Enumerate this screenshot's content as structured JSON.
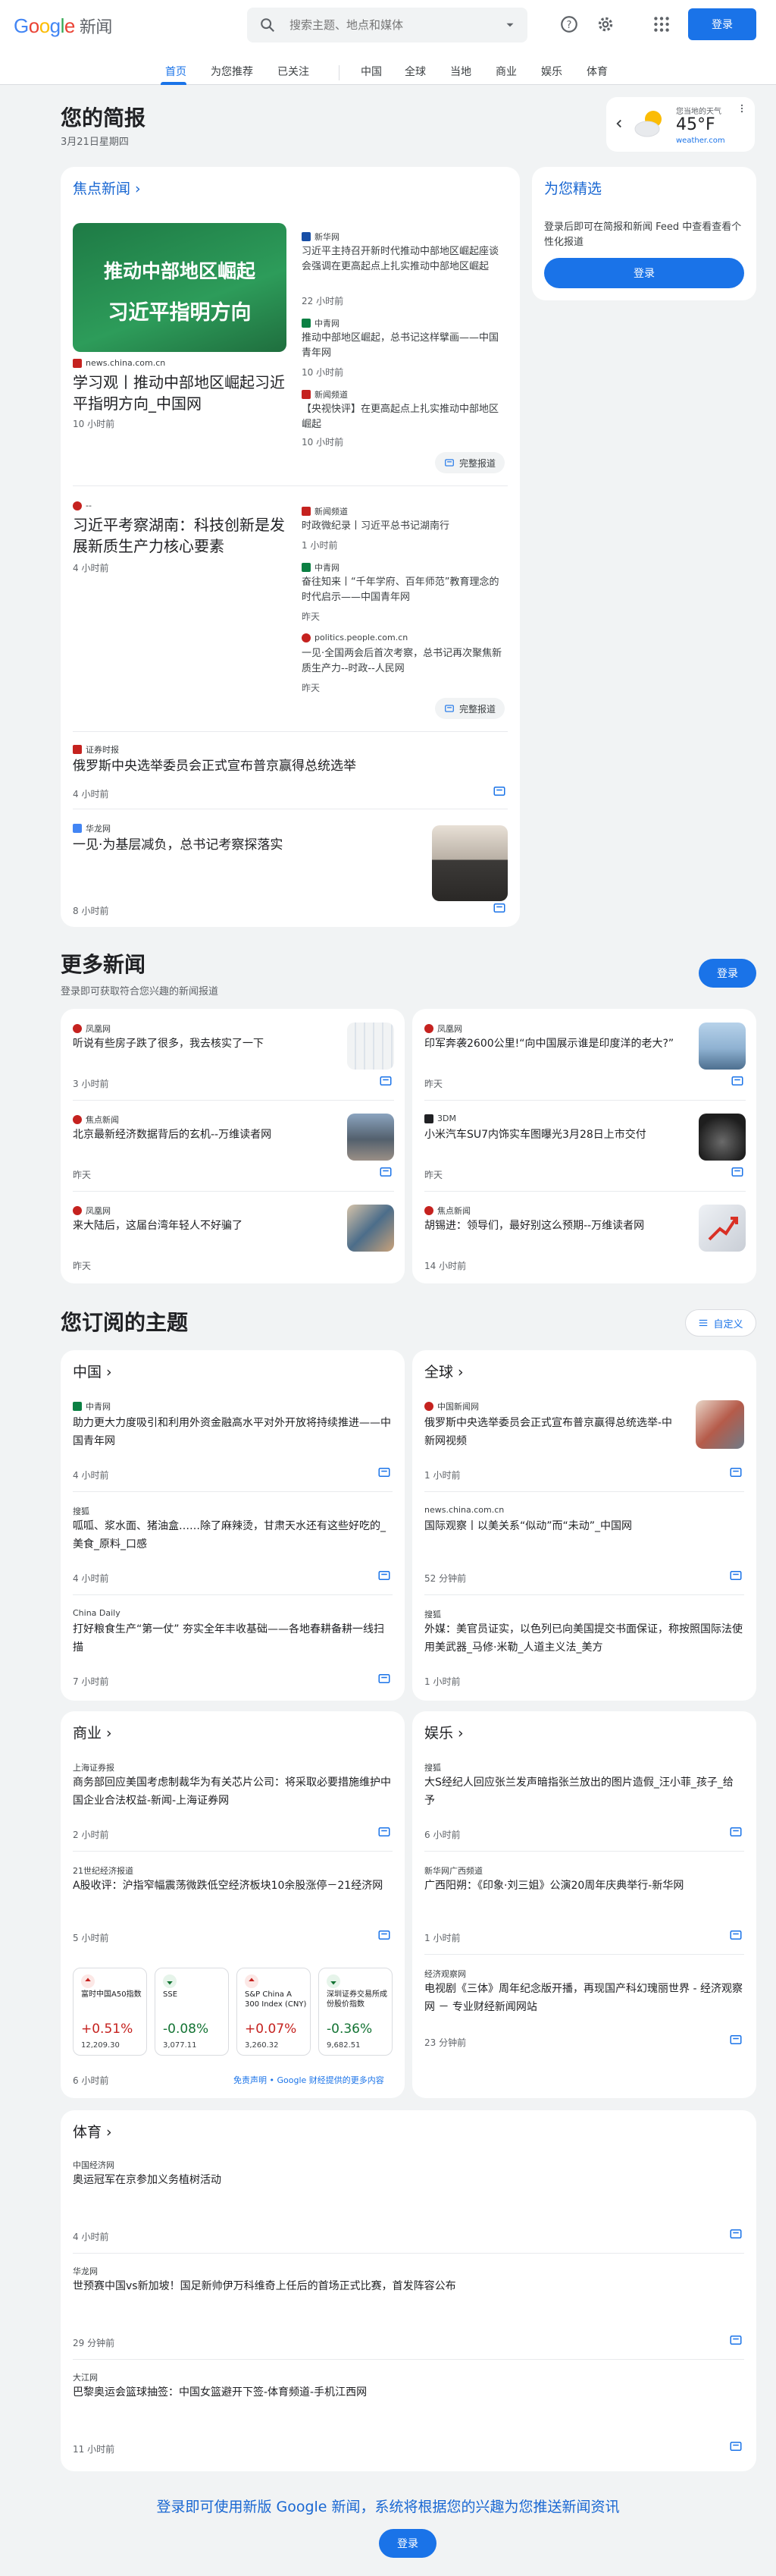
{
  "header": {
    "logo_google": "Google",
    "logo_news": "新闻",
    "search_placeholder": "搜索主题、地点和媒体",
    "signin": "登录"
  },
  "nav": [
    "首页",
    "为您推荐",
    "已关注",
    "中国",
    "全球",
    "当地",
    "商业",
    "娱乐",
    "体育"
  ],
  "briefing": {
    "title": "您的简报",
    "date": "3月21日星期四"
  },
  "weather": {
    "label": "您当地的天气",
    "temp": "45°F",
    "source": "weather.com"
  },
  "top": {
    "heading": "焦点新闻",
    "thumb_line1": "推动中部地区崛起",
    "thumb_line2": "习近平指明方向",
    "main1": {
      "source": "news.china.com.cn",
      "title": "学习观丨推动中部地区崛起习近平指明方向_中国网",
      "time": "10 小时前"
    },
    "side1": [
      {
        "source": "新华网",
        "title": "习近平主持召开新时代推动中部地区崛起座谈会强调在更高起点上扎实推动中部地区崛起",
        "time": "22 小时前"
      },
      {
        "source": "中青网",
        "title": "推动中部地区崛起，总书记这样擘画——中国青年网",
        "time": "10 小时前"
      },
      {
        "source": "新闻频道",
        "title": "【央视快评】在更高起点上扎实推动中部地区崛起",
        "time": "10 小时前"
      }
    ],
    "full_coverage": "完整报道",
    "main2": {
      "source": "--",
      "title": "习近平考察湖南：科技创新是发展新质生产力核心要素",
      "time": "4 小时前"
    },
    "side2": [
      {
        "source": "新闻频道",
        "title": "时政微纪录丨习近平总书记湖南行",
        "time": "1 小时前"
      },
      {
        "source": "中青网",
        "title": "奋往知来丨“千年学府、百年师范”教育理念的时代启示——中国青年网",
        "time": "昨天"
      },
      {
        "source": "politics.people.com.cn",
        "title": "一见·全国两会后首次考察，总书记再次聚焦新质生产力--时政--人民网",
        "time": "昨天"
      }
    ],
    "story3": {
      "source": "证券时报",
      "title": "俄罗斯中央选举委员会正式宣布普京赢得总统选举",
      "time": "4 小时前"
    },
    "story4": {
      "source": "华龙网",
      "title": "一见·为基层减负，总书记考察探落实",
      "time": "8 小时前"
    }
  },
  "picks": {
    "title": "为您精选",
    "text": "登录后即可在简报和新闻 Feed 中查看查看个性化报道",
    "button": "登录"
  },
  "more": {
    "title": "更多新闻",
    "sub": "登录即可获取符合您兴趣的新闻报道",
    "button": "登录",
    "items": [
      {
        "source": "凤凰网",
        "title": "听说有些房子跌了很多，我去核实了一下",
        "time": "3 小时前"
      },
      {
        "source": "凤凰网",
        "title": "印军奔袭2600公里!“向中国展示谁是印度洋的老大?”",
        "time": "昨天"
      },
      {
        "source": "焦点新闻",
        "title": "北京最新经济数据背后的玄机--万维读者网",
        "time": "昨天"
      },
      {
        "source": "3DM",
        "title": "小米汽车SU7内饰实车图曝光3月28日上市交付",
        "time": "昨天"
      },
      {
        "source": "凤凰网",
        "title": "来大陆后，这届台湾年轻人不好骗了",
        "time": "昨天"
      },
      {
        "source": "焦点新闻",
        "title": "胡锡进：领导们，最好别这么预期--万维读者网",
        "time": "14 小时前"
      }
    ]
  },
  "topics": {
    "title": "您订阅的主题",
    "customize": "自定义",
    "china": {
      "title": "中国",
      "items": [
        {
          "source": "中青网",
          "title": "助力更大力度吸引和利用外资金融高水平对外开放将持续推进——中国青年网",
          "time": "4 小时前"
        },
        {
          "source": "搜狐",
          "title": "呱呱、浆水面、猪油盒……除了麻辣烫，甘肃天水还有这些好吃的_美食_原料_口感",
          "time": "4 小时前"
        },
        {
          "source": "China Daily",
          "title": "打好粮食生产“第一仗” 夯实全年丰收基础——各地春耕备耕一线扫描",
          "time": "7 小时前"
        }
      ]
    },
    "world": {
      "title": "全球",
      "items": [
        {
          "source": "中国新闻网",
          "title": "俄罗斯中央选举委员会正式宣布普京赢得总统选举-中新网视频",
          "time": "1 小时前"
        },
        {
          "source": "news.china.com.cn",
          "title": "国际观察丨以美关系“似动”而“未动”_中国网",
          "time": "52 分钟前"
        },
        {
          "source": "搜狐",
          "title": "外媒：美官员证实，以色列已向美国提交书面保证，称按照国际法使用美武器_马修·米勒_人道主义法_美方",
          "time": "1 小时前"
        }
      ]
    },
    "biz": {
      "title": "商业",
      "items": [
        {
          "source": "上海证券报",
          "title": "商务部回应美国考虑制裁华为有关芯片公司：将采取必要措施维护中国企业合法权益-新闻-上海证券网",
          "time": "2 小时前"
        },
        {
          "source": "21世纪经济报道",
          "title": "A股收评：沪指窄幅震荡微跌低空经济板块10余股涨停－21经济网",
          "time": "5 小时前"
        }
      ],
      "stocks": [
        {
          "name": "富时中国A50指数",
          "change": "+0.51%",
          "value": "12,209.30",
          "up": false
        },
        {
          "name": "SSE",
          "change": "-0.08%",
          "value": "3,077.11",
          "up": true
        },
        {
          "name": "S&P China A 300 Index (CNY)",
          "change": "+0.07%",
          "value": "3,260.32",
          "up": false
        },
        {
          "name": "深圳证券交易所成份股价指数",
          "change": "-0.36%",
          "value": "9,682.51",
          "up": true
        }
      ],
      "time": "6 小时前",
      "disclaimer": "免责声明 • Google 财经提供的更多内容"
    },
    "ent": {
      "title": "娱乐",
      "items": [
        {
          "source": "搜狐",
          "title": "大S经纪人回应张兰发声暗指张兰放出的图片造假_汪小菲_孩子_给予",
          "time": "6 小时前"
        },
        {
          "source": "新华网广西频道",
          "title": "广西阳朔：《印象·刘三姐》公演20周年庆典举行-新华网",
          "time": "1 小时前"
        },
        {
          "source": "经济观察网",
          "title": "电视剧《三体》周年纪念版开播，再现国产科幻瑰丽世界 - 经济观察网 － 专业财经新闻网站",
          "time": "23 分钟前"
        }
      ]
    },
    "sports": {
      "title": "体育",
      "items": [
        {
          "source": "中国经济网",
          "title": "奥运冠军在京参加义务植树活动",
          "time": "4 小时前"
        },
        {
          "source": "华龙网",
          "title": "世预赛中国vs新加坡！国足新帅伊万科维奇上任后的首场正式比赛，首发阵容公布",
          "time": "29 分钟前"
        },
        {
          "source": "大江网",
          "title": "巴黎奥运会篮球抽签：中国女篮避开下签-体育频道-手机江西网",
          "time": "11 小时前"
        }
      ]
    }
  },
  "footer": {
    "text": "登录即可使用新版 Google 新闻，系统将根据您的兴趣为您推送新闻资讯",
    "button": "登录"
  },
  "colors": {
    "accent": "#1a73e8",
    "up": "#137333",
    "down": "#c5221f"
  }
}
